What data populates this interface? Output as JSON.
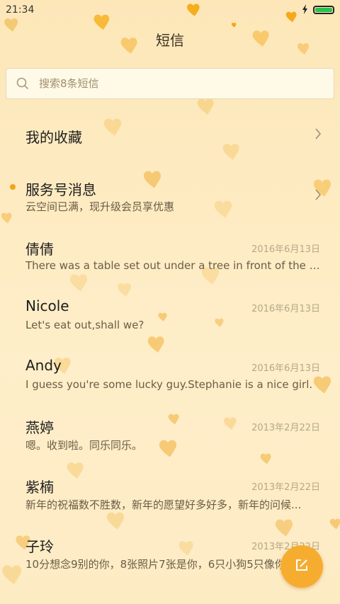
{
  "status": {
    "time": "21:34"
  },
  "header": {
    "title": "短信"
  },
  "search": {
    "placeholder": "搜索8条短信"
  },
  "colors": {
    "accent": "#f6ad2f",
    "unread_dot": "#f3a316",
    "battery": "#29c24a"
  },
  "special_items": [
    {
      "label": "我的收藏"
    },
    {
      "label": "服务号消息",
      "subtitle": "云空间已满，现升级会员享优惠"
    }
  ],
  "conversations": [
    {
      "name": "倩倩",
      "date": "2016年6月13日",
      "preview": "There was a table set out under a tree in front of the house..."
    },
    {
      "name": "Nicole",
      "date": "2016年6月13日",
      "preview": "Let's eat out,shall we?"
    },
    {
      "name": "Andy",
      "date": "2016年6月13日",
      "preview": "I guess you're some lucky guy.Stephanie is a nice girl."
    },
    {
      "name": "燕婷",
      "date": "2013年2月22日",
      "preview": "嗯。收到啦。同乐同乐。"
    },
    {
      "name": "紫楠",
      "date": "2013年2月22日",
      "preview": "新年的祝福数不胜数，新年的愿望好多好多，新年的问候..."
    },
    {
      "name": "子玲",
      "date": "2013年2月22日",
      "preview": "10分想念9别的你，8张照片7张是你，6只小狗5只像你..."
    }
  ],
  "icons": {
    "search": "search-icon",
    "chevron": "chevron-right-icon",
    "compose": "compose-icon",
    "charging": "lightning-icon"
  }
}
